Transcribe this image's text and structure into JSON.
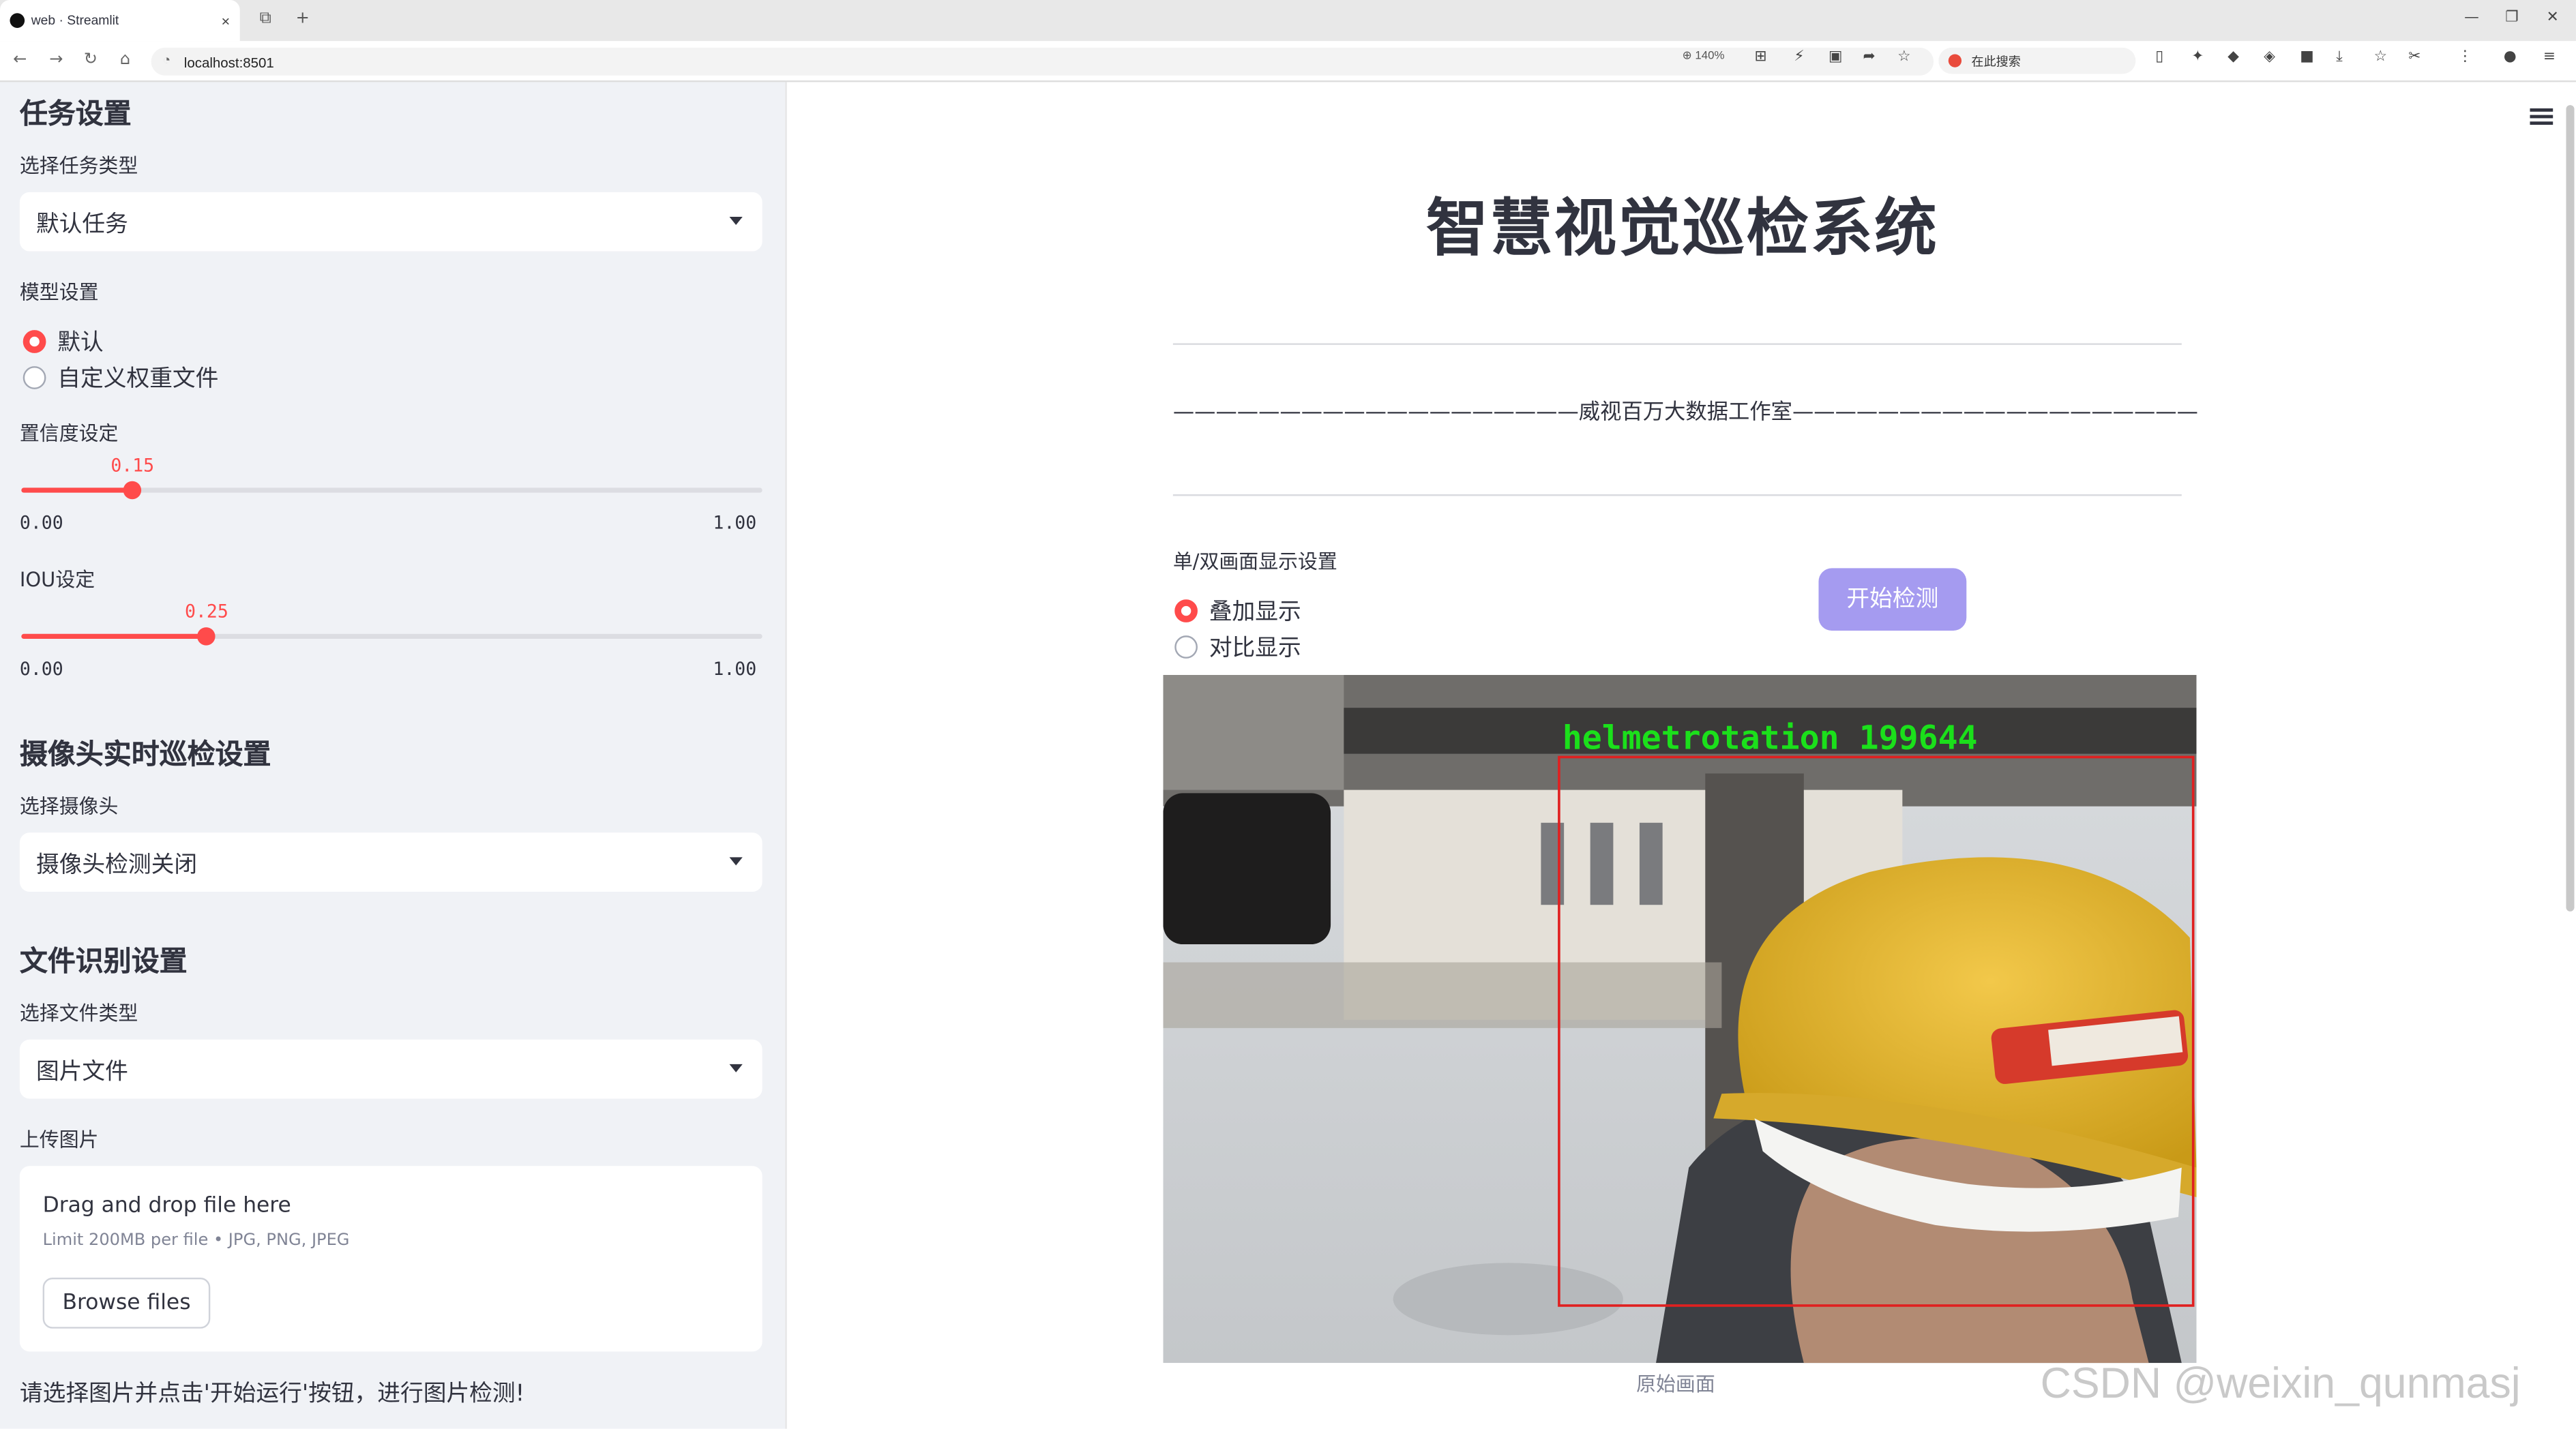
{
  "browser": {
    "tab_title": "web · Streamlit",
    "tab_close": "×",
    "new_tab": "+",
    "url": "localhost:8501",
    "zoom": "140%",
    "search_placeholder": "在此搜索",
    "nav_icons": [
      "back-arrow-icon",
      "forward-arrow-icon",
      "reload-icon",
      "home-icon"
    ]
  },
  "sidebar": {
    "task_heading": "任务设置",
    "task_type_label": "选择任务类型",
    "task_type_value": "默认任务",
    "model_label": "模型设置",
    "model_options": [
      "默认",
      "自定义权重文件"
    ],
    "model_selected": "默认",
    "conf_label": "置信度设定",
    "conf_value": 0.15,
    "conf_value_text": "0.15",
    "conf_min": "0.00",
    "conf_max": "1.00",
    "iou_label": "IOU设定",
    "iou_value": 0.25,
    "iou_value_text": "0.25",
    "iou_min": "0.00",
    "iou_max": "1.00",
    "camera_heading": "摄像头实时巡检设置",
    "camera_label": "选择摄像头",
    "camera_value": "摄像头检测关闭",
    "file_heading": "文件识别设置",
    "file_type_label": "选择文件类型",
    "file_type_value": "图片文件",
    "upload_label": "上传图片",
    "upload_title": "Drag and drop file here",
    "upload_limit": "Limit 200MB per file • JPG, PNG, JPEG",
    "browse_button": "Browse files",
    "note": "请选择图片并点击'开始运行'按钮，进行图片检测!"
  },
  "main": {
    "title": "智慧视觉巡检系统",
    "banner": "———————————————————威视百万大数据工作室———————————————————",
    "display_label": "单/双画面显示设置",
    "display_options": [
      "叠加显示",
      "对比显示"
    ],
    "display_selected": "叠加显示",
    "start_button": "开始检测",
    "detection_label": "helmetrotation 199644",
    "caption": "原始画面",
    "watermark": "CSDN @weixin_qunmasj",
    "accent_color": "#ff4b4b",
    "button_color": "#a59bf0"
  }
}
